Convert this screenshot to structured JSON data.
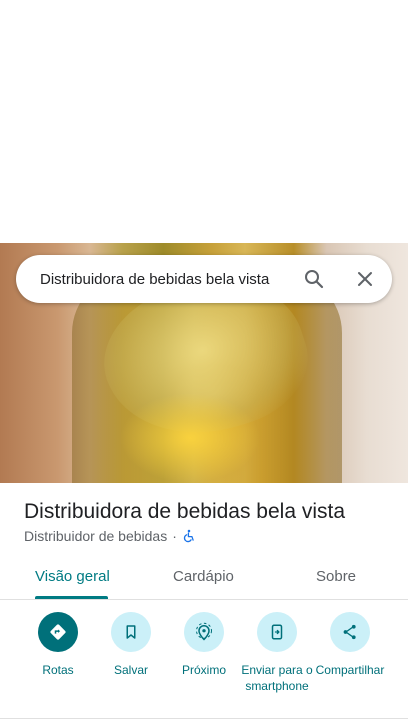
{
  "search": {
    "query": "Distribuidora de bebidas bela vista"
  },
  "place": {
    "title": "Distribuidora de bebidas bela vista",
    "category": "Distribuidor de bebidas",
    "separator": "·"
  },
  "tabs": [
    {
      "label": "Visão geral",
      "active": true
    },
    {
      "label": "Cardápio",
      "active": false
    },
    {
      "label": "Sobre",
      "active": false
    }
  ],
  "actions": [
    {
      "label": "Rotas",
      "icon": "directions-icon"
    },
    {
      "label": "Salvar",
      "icon": "bookmark-icon"
    },
    {
      "label": "Próximo",
      "icon": "nearby-icon"
    },
    {
      "label": "Enviar para o smartphone",
      "icon": "send-to-phone-icon"
    },
    {
      "label": "Compartilhar",
      "icon": "share-icon"
    }
  ],
  "colors": {
    "accent": "#00707a",
    "accent_light": "#cbf0f8",
    "tab_active": "#007b83",
    "wheelchair_icon": "#1a73e8"
  }
}
